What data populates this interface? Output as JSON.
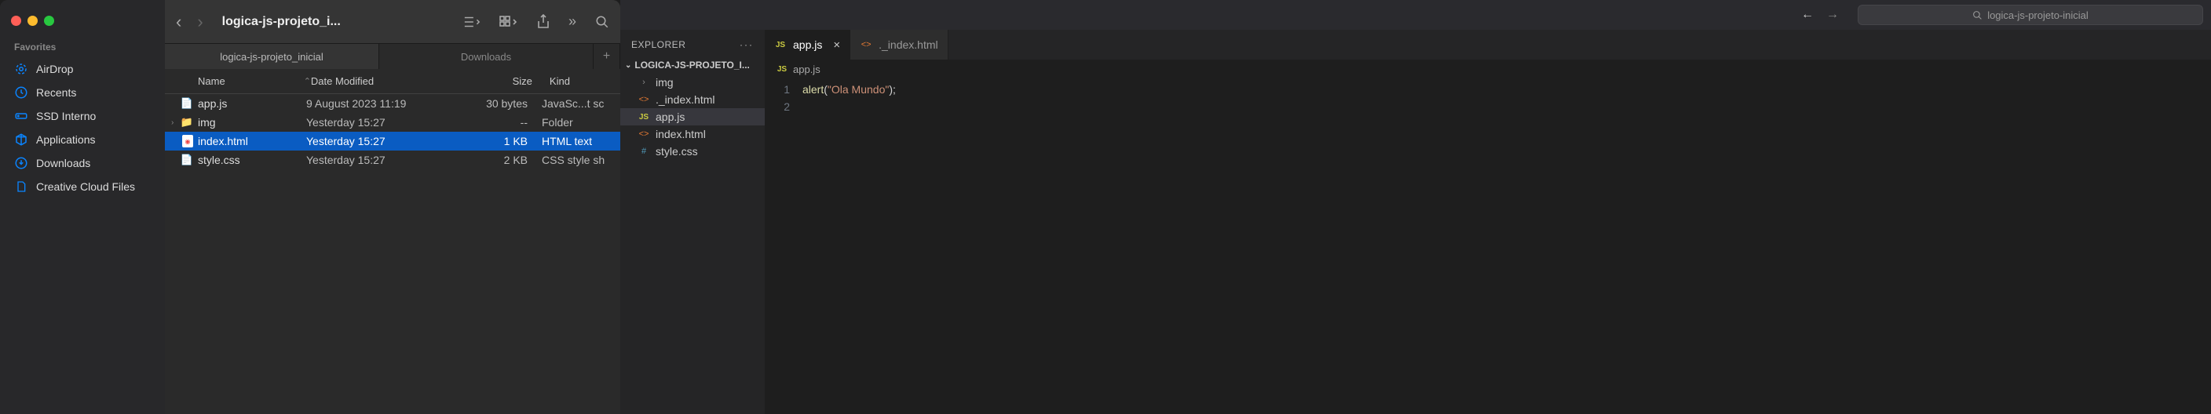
{
  "finder": {
    "title": "logica-js-projeto_i...",
    "sidebar": {
      "section": "Favorites",
      "items": [
        {
          "label": "AirDrop",
          "icon": "airdrop"
        },
        {
          "label": "Recents",
          "icon": "clock"
        },
        {
          "label": "SSD Interno",
          "icon": "drive"
        },
        {
          "label": "Applications",
          "icon": "apps"
        },
        {
          "label": "Downloads",
          "icon": "download"
        },
        {
          "label": "Creative Cloud Files",
          "icon": "file"
        }
      ]
    },
    "tabs": [
      {
        "label": "logica-js-projeto_inicial",
        "active": true
      },
      {
        "label": "Downloads",
        "active": false
      }
    ],
    "columns": {
      "name": "Name",
      "date": "Date Modified",
      "size": "Size",
      "kind": "Kind"
    },
    "files": [
      {
        "name": "app.js",
        "date": "9 August 2023 11:19",
        "size": "30 bytes",
        "kind": "JavaSc...t sc",
        "icon": "doc",
        "selected": false,
        "expandable": false
      },
      {
        "name": "img",
        "date": "Yesterday 15:27",
        "size": "--",
        "kind": "Folder",
        "icon": "folder",
        "selected": false,
        "expandable": true
      },
      {
        "name": "index.html",
        "date": "Yesterday 15:27",
        "size": "1 KB",
        "kind": "HTML text",
        "icon": "html",
        "selected": true,
        "expandable": false
      },
      {
        "name": "style.css",
        "date": "Yesterday 15:27",
        "size": "2 KB",
        "kind": "CSS style sh",
        "icon": "doc",
        "selected": false,
        "expandable": false
      }
    ]
  },
  "vscode": {
    "search_placeholder": "logica-js-projeto-inicial",
    "explorer_title": "EXPLORER",
    "project_name": "LOGICA-JS-PROJETO_I...",
    "tree": [
      {
        "label": "img",
        "type": "folder",
        "active": false
      },
      {
        "label": "._index.html",
        "type": "html",
        "active": false
      },
      {
        "label": "app.js",
        "type": "js",
        "active": true
      },
      {
        "label": "index.html",
        "type": "html",
        "active": false
      },
      {
        "label": "style.css",
        "type": "css",
        "active": false
      }
    ],
    "tabs": [
      {
        "label": "app.js",
        "type": "js",
        "active": true,
        "close": true
      },
      {
        "label": "._index.html",
        "type": "html",
        "active": false,
        "close": false
      }
    ],
    "breadcrumb": "app.js",
    "code": {
      "line1_func": "alert",
      "line1_open": "(",
      "line1_str": "\"Ola Mundo\"",
      "line1_close": ");"
    },
    "line_numbers": [
      "1",
      "2"
    ]
  }
}
